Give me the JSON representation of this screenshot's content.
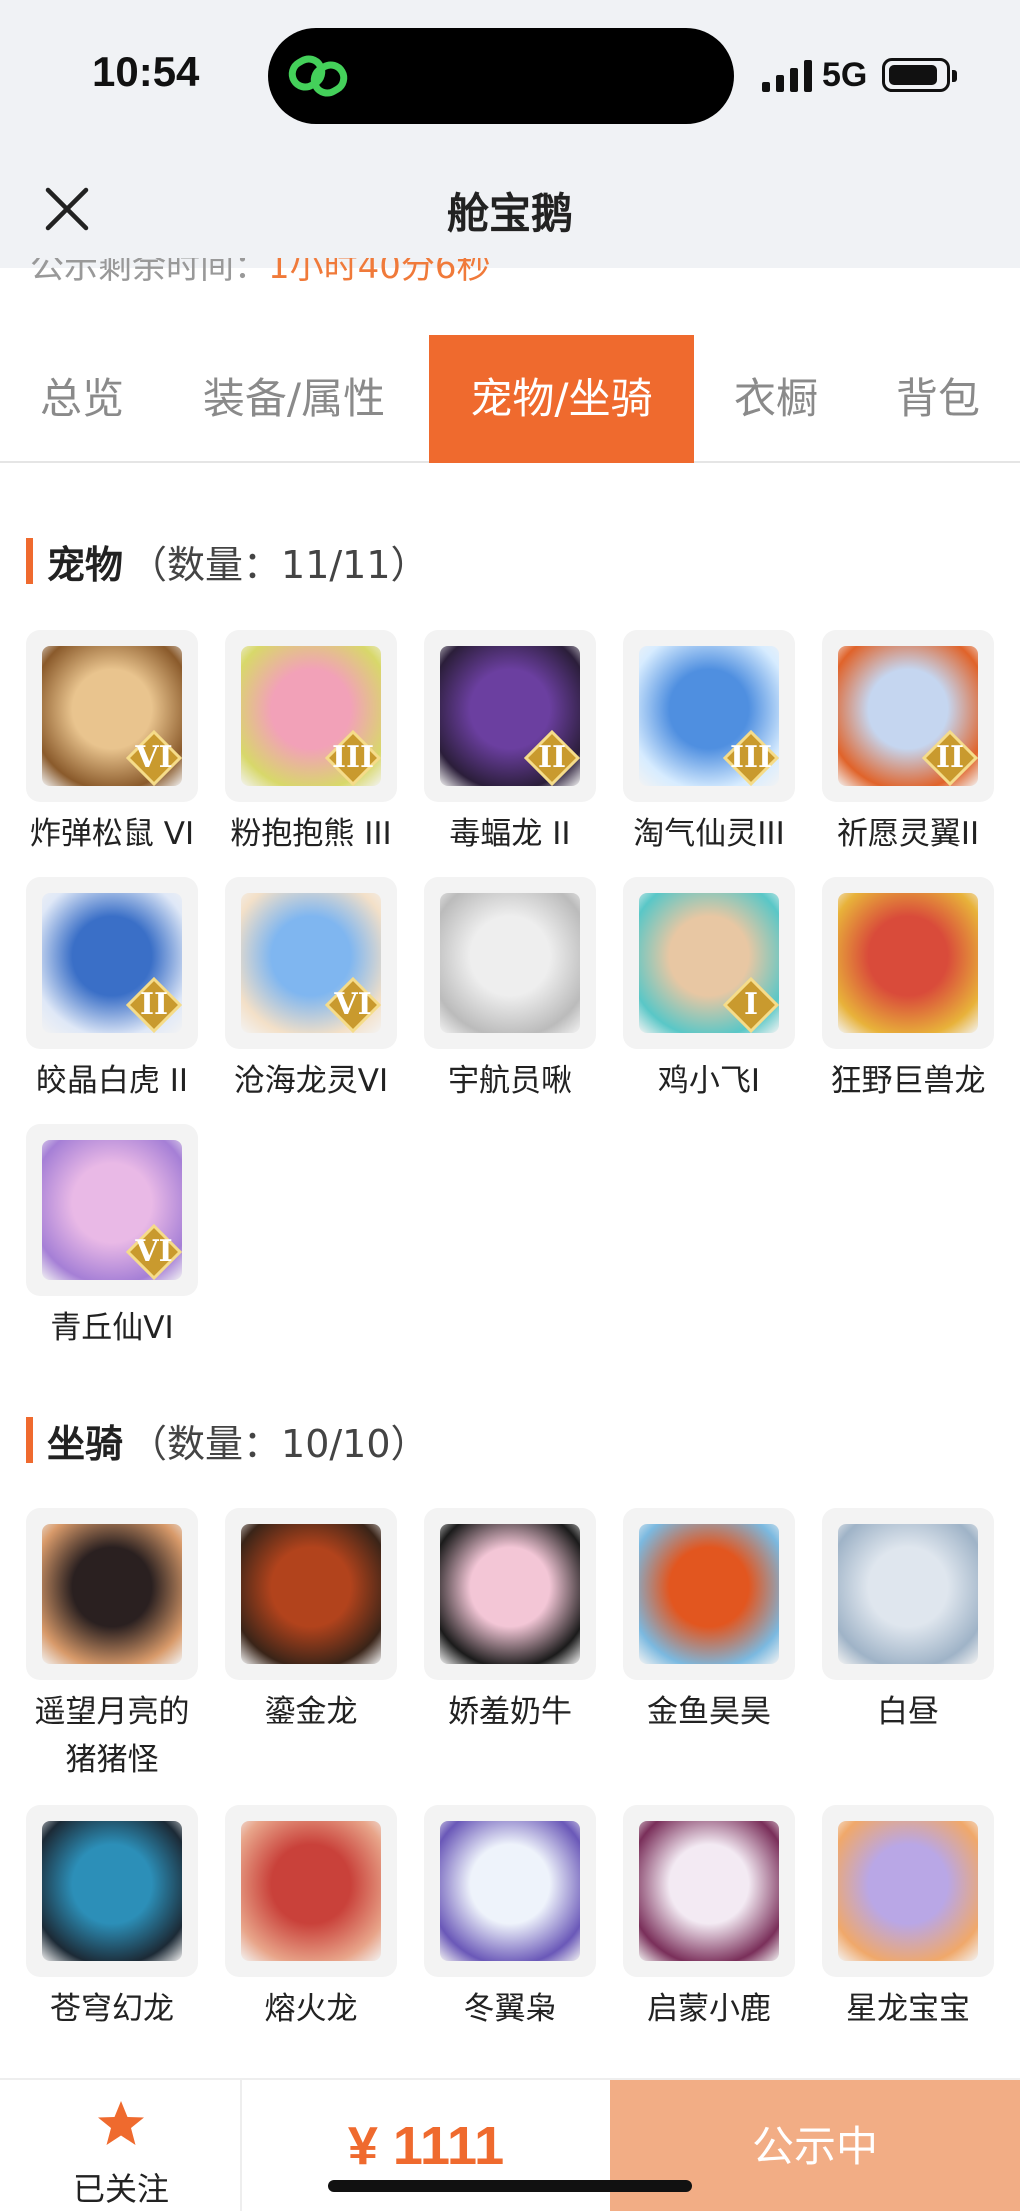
{
  "status_bar": {
    "time": "10:54",
    "network": "5G"
  },
  "nav": {
    "title": "舱宝鹅"
  },
  "peek_text": {
    "label": "公示剩余时间：",
    "value": "1小时40分6秒"
  },
  "tabs": [
    {
      "label": "总览",
      "active": false
    },
    {
      "label": "装备/属性",
      "active": false
    },
    {
      "label": "宠物/坐骑",
      "active": true
    },
    {
      "label": "衣橱",
      "active": false
    },
    {
      "label": "背包",
      "active": false
    }
  ],
  "pets": {
    "title": "宠物",
    "count": "（数量：11/11）",
    "items": [
      {
        "name": "炸弹松鼠 VI",
        "tier": "VI"
      },
      {
        "name": "粉抱抱熊 III",
        "tier": "III"
      },
      {
        "name": "毒蝠龙 II",
        "tier": "II"
      },
      {
        "name": "淘气仙灵III",
        "tier": "III"
      },
      {
        "name": "祈愿灵翼II",
        "tier": "II"
      },
      {
        "name": "皎晶白虎 II",
        "tier": "II"
      },
      {
        "name": "沧海龙灵VI",
        "tier": "VI"
      },
      {
        "name": "宇航员啾",
        "tier": ""
      },
      {
        "name": "鸡小飞I",
        "tier": "I"
      },
      {
        "name": "狂野巨兽龙",
        "tier": ""
      },
      {
        "name": "青丘仙VI",
        "tier": "VI"
      }
    ]
  },
  "mounts": {
    "title": "坐骑",
    "count": "（数量：10/10）",
    "items": [
      {
        "name": "遥望月亮的猪猪怪"
      },
      {
        "name": "鎏金龙"
      },
      {
        "name": "娇羞奶牛"
      },
      {
        "name": "金鱼昊昊"
      },
      {
        "name": "白昼"
      },
      {
        "name": "苍穹幻龙"
      },
      {
        "name": "熔火龙"
      },
      {
        "name": "冬翼枭"
      },
      {
        "name": "启蒙小鹿"
      },
      {
        "name": "星龙宝宝"
      }
    ]
  },
  "bottom": {
    "follow_label": "已关注",
    "price": "¥ 1111",
    "status_label": "公示中"
  },
  "colors": {
    "accent": "#ef6a2e",
    "status_bg": "#f2ad85",
    "page_bg": "#f0f2f5"
  }
}
